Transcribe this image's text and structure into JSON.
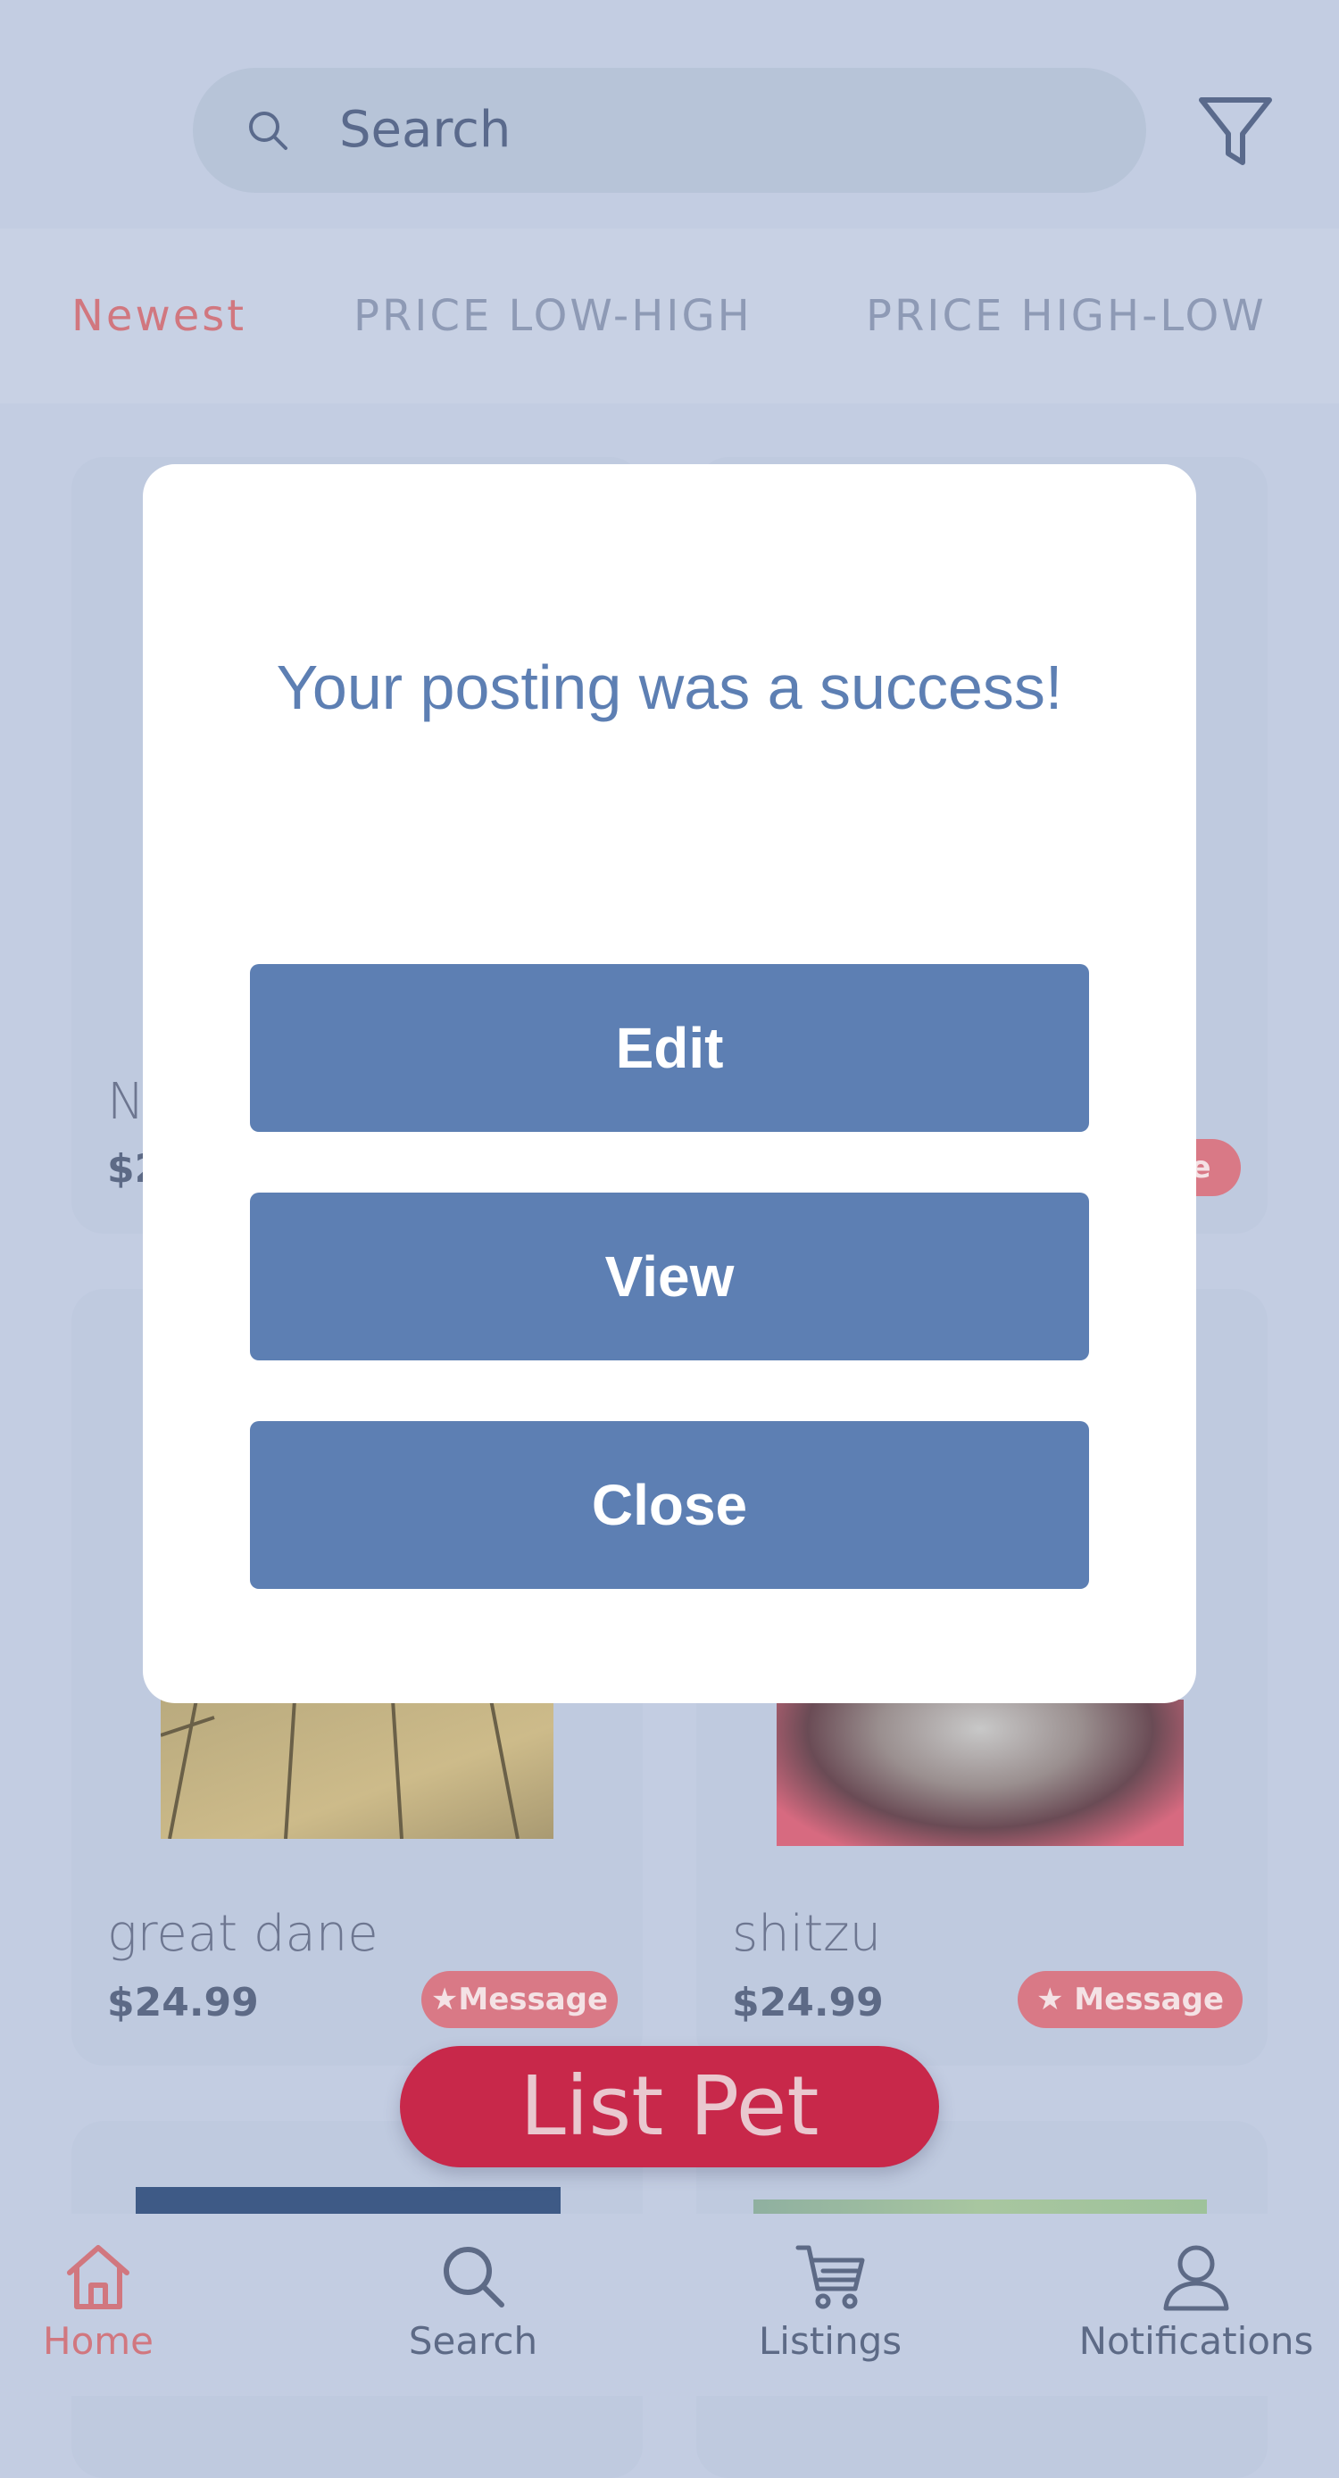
{
  "search": {
    "placeholder": "Search"
  },
  "sort_tabs": [
    {
      "label": "Newest",
      "active": true
    },
    {
      "label": "PRICE LOW-HIGH",
      "active": false
    },
    {
      "label": "PRICE HIGH-LOW",
      "active": false
    }
  ],
  "cards": [
    {
      "name": "N",
      "price": "$2",
      "message_label": ""
    },
    {
      "name": "",
      "price": "",
      "message_label": "e"
    },
    {
      "name": "great dane",
      "price": "$24.99",
      "message_label": "★Message"
    },
    {
      "name": "shitzu",
      "price": "$24.99",
      "message_label": "★ Message"
    }
  ],
  "list_pet_label": "List Pet",
  "modal": {
    "title": "Your posting was a success!",
    "buttons": {
      "edit": "Edit",
      "view": "View",
      "close": "Close"
    }
  },
  "bottom_nav": [
    {
      "label": "Home",
      "icon": "home-icon",
      "active": true
    },
    {
      "label": "Search",
      "icon": "search-icon",
      "active": false
    },
    {
      "label": "Listings",
      "icon": "cart-icon",
      "active": false
    },
    {
      "label": "Notifications",
      "icon": "user-icon",
      "active": false
    }
  ],
  "colors": {
    "accent_red": "#c8284a",
    "active_pink": "#d1777f",
    "button_blue": "#5d7fb3",
    "overlay_bg": "#c3cde2"
  }
}
